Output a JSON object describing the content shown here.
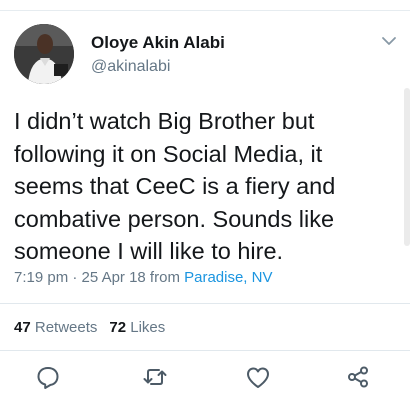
{
  "user": {
    "display_name": "Oloye Akin Alabi",
    "handle": "@akinalabi"
  },
  "tweet": {
    "text": "I didn’t watch Big Brother but\nfollowing it on Social Media, it\nseems that CeeC is a fiery and\ncombative person. Sounds like\nsomeone I will like to hire.",
    "time": "7:19 pm",
    "separator": " · ",
    "date": "25 Apr 18",
    "from_label": " from ",
    "location": "Paradise, NV"
  },
  "stats": {
    "retweets_count": "47",
    "retweets_label": "Retweets",
    "likes_count": "72",
    "likes_label": "Likes"
  },
  "actions": {
    "reply_icon": "reply-icon",
    "retweet_icon": "retweet-icon",
    "like_icon": "heart-icon",
    "share_icon": "share-icon"
  },
  "colors": {
    "text": "#14171a",
    "muted": "#657786",
    "link": "#1b95e0"
  }
}
